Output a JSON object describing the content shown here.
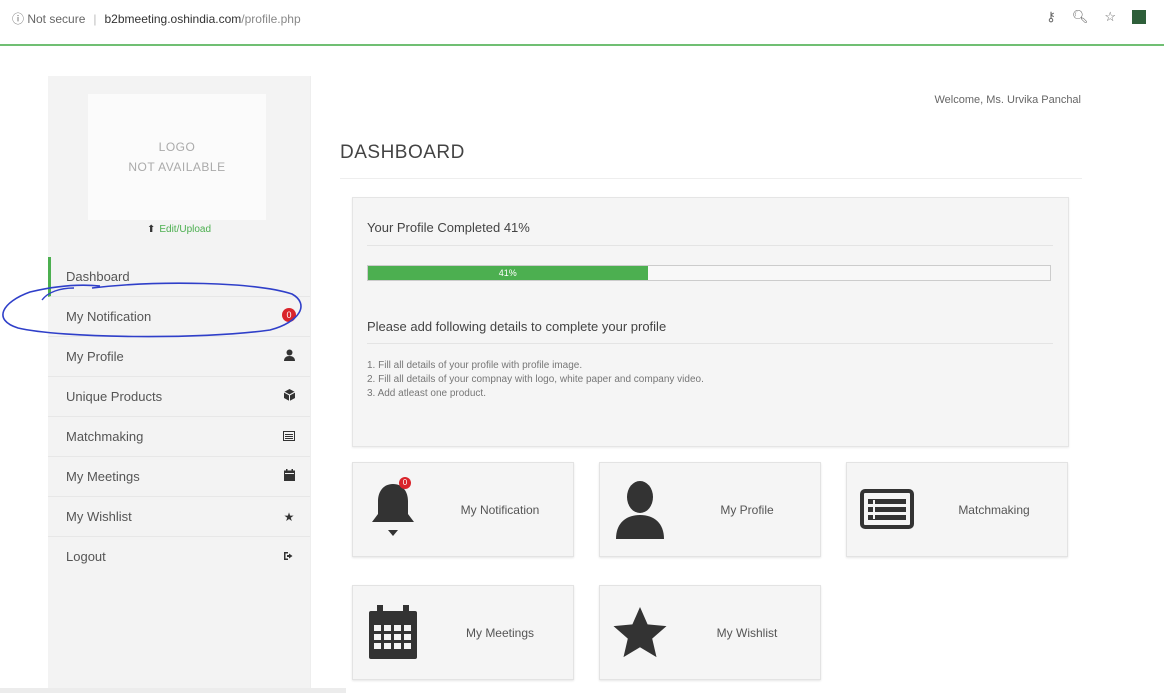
{
  "browser": {
    "security": "Not secure",
    "host": "b2bmeeting.oshindia.com",
    "path": "/profile.php",
    "icons": [
      "key-icon",
      "zoom-icon",
      "star-icon",
      "extension-icon"
    ]
  },
  "sidebar": {
    "logo_line1": "LOGO",
    "logo_line2": "NOT AVAILABLE",
    "edit_upload": "Edit/Upload",
    "items": [
      {
        "label": "Dashboard",
        "icon": ""
      },
      {
        "label": "My Notification",
        "icon": "bell-icon",
        "badge": "0"
      },
      {
        "label": "My Profile",
        "icon": "user-icon"
      },
      {
        "label": "Unique Products",
        "icon": "cube-icon"
      },
      {
        "label": "Matchmaking",
        "icon": "list-icon"
      },
      {
        "label": "My Meetings",
        "icon": "calendar-icon"
      },
      {
        "label": "My Wishlist",
        "icon": "star-icon"
      },
      {
        "label": "Logout",
        "icon": "logout-icon"
      }
    ]
  },
  "main": {
    "welcome": "Welcome, Ms. Urvika Panchal",
    "title": "DASHBOARD",
    "profile": {
      "heading": "Your Profile Completed 41%",
      "progress_percent": 41,
      "progress_label": "41%",
      "subheading": "Please add following details to complete your profile",
      "tasks": [
        "1. Fill all details of your profile with profile image.",
        "2. Fill all details of your compnay with logo, white paper and company video.",
        "3. Add atleast one product."
      ]
    },
    "tiles": [
      {
        "label": "My Notification",
        "icon": "bell-icon",
        "badge": "0"
      },
      {
        "label": "My Profile",
        "icon": "user-icon"
      },
      {
        "label": "Matchmaking",
        "icon": "list-icon"
      },
      {
        "label": "My Meetings",
        "icon": "calendar-icon"
      },
      {
        "label": "My Wishlist",
        "icon": "star-icon"
      }
    ]
  },
  "colors": {
    "accent": "#4caf50",
    "badge": "#d9242b",
    "annotation": "#2f3fc9"
  }
}
